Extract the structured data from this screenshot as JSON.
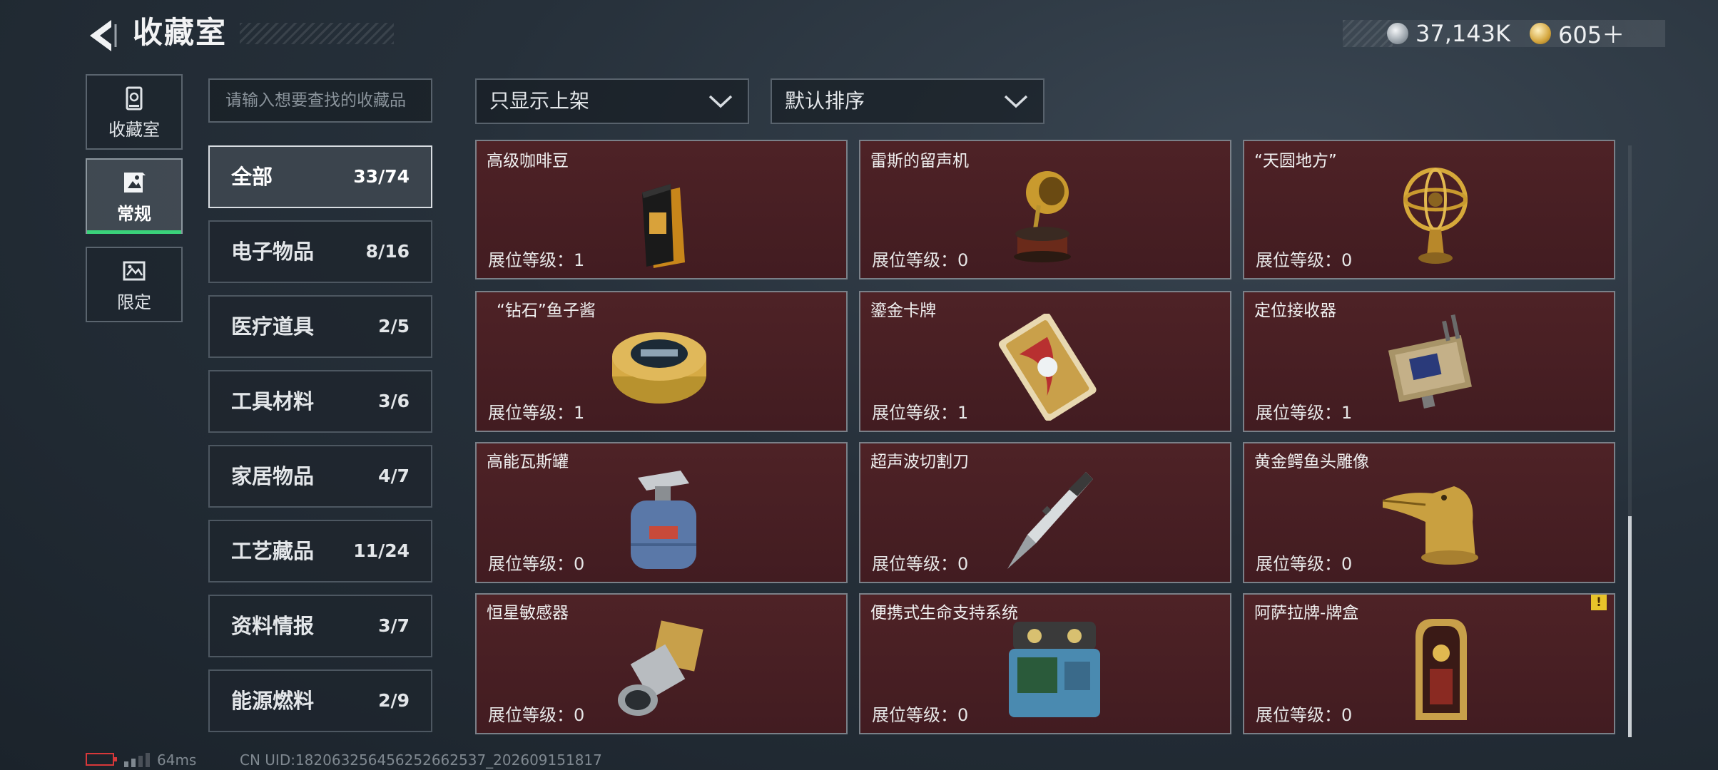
{
  "header": {
    "title": "收藏室",
    "currencies": [
      {
        "icon": "silver-coin-icon",
        "value": "37,143K"
      },
      {
        "icon": "gold-coin-icon",
        "value": "605＋"
      }
    ]
  },
  "nav": {
    "tabs": [
      {
        "label": "收藏室",
        "icon": "vault-icon",
        "active": false
      },
      {
        "label": "常规",
        "icon": "collection-icon",
        "active": true
      },
      {
        "label": "限定",
        "icon": "limited-icon",
        "active": false
      }
    ]
  },
  "search": {
    "placeholder": "请输入想要查找的收藏品",
    "value": ""
  },
  "filters": {
    "display": "只显示上架",
    "sort": "默认排序"
  },
  "categories": [
    {
      "name": "全部",
      "count": "33/74",
      "active": true
    },
    {
      "name": "电子物品",
      "count": "8/16"
    },
    {
      "name": "医疗道具",
      "count": "2/5"
    },
    {
      "name": "工具材料",
      "count": "3/6"
    },
    {
      "name": "家居物品",
      "count": "4/7"
    },
    {
      "name": "工艺藏品",
      "count": "11/24"
    },
    {
      "name": "资料情报",
      "count": "3/7"
    },
    {
      "name": "能源燃料",
      "count": "2/9"
    }
  ],
  "items": [
    {
      "name": "高级咖啡豆",
      "level": "展位等级：1",
      "icon": "coffee-bag-icon"
    },
    {
      "name": "雷斯的留声机",
      "level": "展位等级：0",
      "icon": "gramophone-icon"
    },
    {
      "name": "“天圆地方”",
      "level": "展位等级：0",
      "icon": "armillary-sphere-icon"
    },
    {
      "name": "“钻石”鱼子酱",
      "level": "展位等级：1",
      "icon": "caviar-tin-icon"
    },
    {
      "name": "鎏金卡牌",
      "level": "展位等级：1",
      "icon": "gilded-card-icon"
    },
    {
      "name": "定位接收器",
      "level": "展位等级：1",
      "icon": "receiver-device-icon"
    },
    {
      "name": "高能瓦斯罐",
      "level": "展位等级：0",
      "icon": "gas-canister-icon"
    },
    {
      "name": "超声波切割刀",
      "level": "展位等级：0",
      "icon": "ultrasonic-knife-icon"
    },
    {
      "name": "黄金鳄鱼头雕像",
      "level": "展位等级：0",
      "icon": "crocodile-statue-icon"
    },
    {
      "name": "恒星敏感器",
      "level": "展位等级：0",
      "icon": "star-sensor-icon"
    },
    {
      "name": "便携式生命支持系统",
      "level": "展位等级：0",
      "icon": "life-support-icon"
    },
    {
      "name": "阿萨拉牌-牌盒",
      "level": "展位等级：0",
      "icon": "card-box-icon",
      "badge": "!"
    }
  ],
  "footer": {
    "ping": "64ms",
    "uid": "CN UID:18206325645625266253​7_202609151817"
  },
  "colors": {
    "item_bg": "#4a1f24",
    "active_underline": "#3ad27a",
    "warning": "#e8c32a"
  }
}
